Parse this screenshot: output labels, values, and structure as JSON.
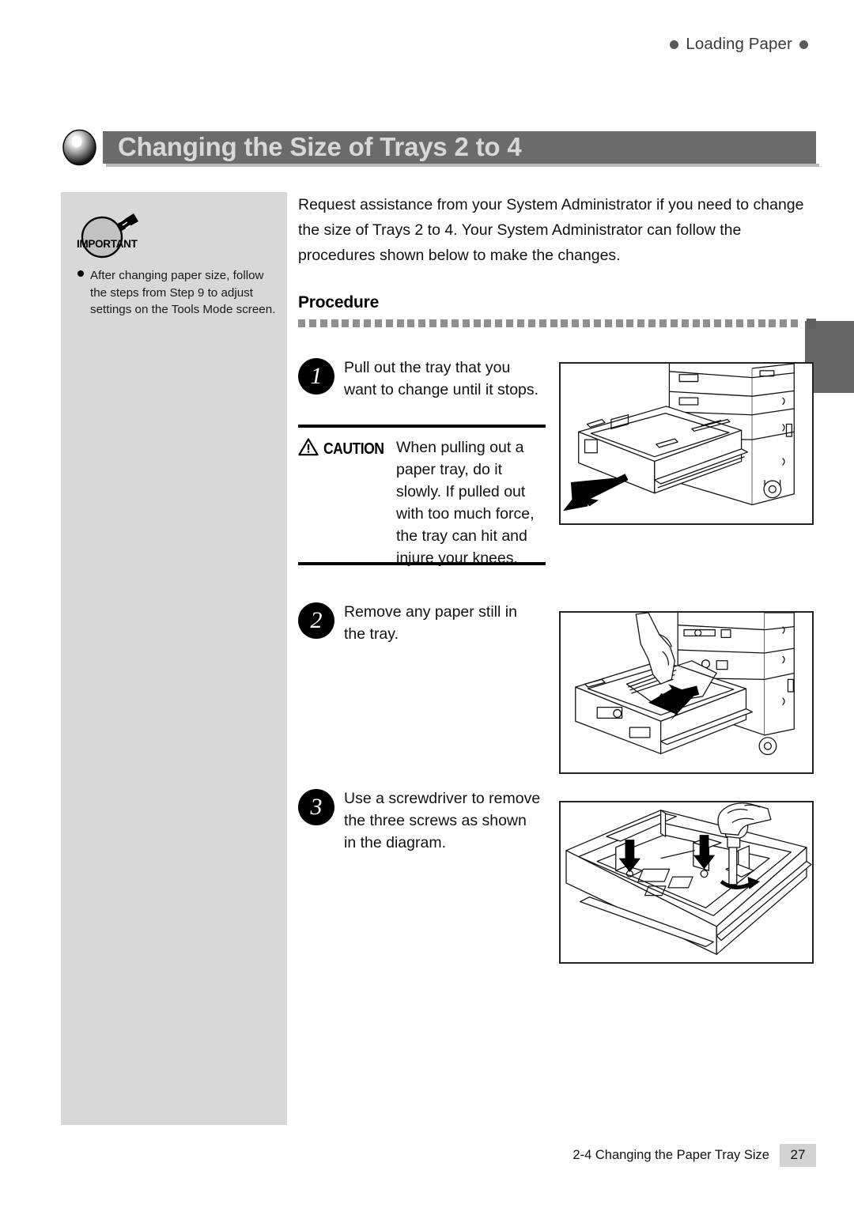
{
  "header": {
    "running_title": "Loading Paper",
    "left_dot_icon": "bullet-dot",
    "right_dot_icon": "bullet-dot"
  },
  "title": {
    "text": "Changing the Size of Trays 2 to 4",
    "icon": "sphere-bullet-icon",
    "bar_color": "#6b6b6b",
    "text_color": "#d8d8d8"
  },
  "sidebar": {
    "background_color": "#d8d8d8",
    "note": {
      "icon": "magnifier-icon",
      "label": "IMPORTANT",
      "bullet_icon": "bullet-dot",
      "text": "After changing paper size, follow the steps from Step 9 to adjust settings on the Tools Mode screen."
    }
  },
  "thumb_tab": {
    "color": "#666666"
  },
  "intro": {
    "text": "Request assistance from your System Administrator if you need to change the size of Trays 2 to 4. Your System Administrator can follow the procedures shown below to make the changes."
  },
  "procedure": {
    "heading": "Procedure",
    "divider_icon": "dotted-square-rule",
    "divider_square_count": 46,
    "divider_color": "#8f8f8f",
    "divider_endcap_color": "#5f5f5f"
  },
  "steps": [
    {
      "number": "1",
      "text": "Pull out the tray that you want to change until it stops.",
      "figure": {
        "name": "tray-pulled-out-figure",
        "alt": "Copier with paper tray pulled out and an arrow pointing out and down-left",
        "arrow_icon": "arrow-down-left"
      }
    },
    {
      "number": "2",
      "text": "Remove any paper still in the tray.",
      "figure": {
        "name": "remove-paper-figure",
        "alt": "A hand lifting paper out of the open tray with an arrow pointing left",
        "arrow_icon": "arrow-left"
      }
    },
    {
      "number": "3",
      "text": "Use a screwdriver to remove the three screws as shown in the diagram.",
      "figure": {
        "name": "remove-screws-figure",
        "alt": "A screwdriver removing screws inside the tray, two down arrows mark screw positions and a curved arrow shows turning",
        "arrow_icon": "arrow-down",
        "rotate_icon": "curved-rotate-arrow"
      }
    }
  ],
  "caution": {
    "icon": "warning-triangle-icon",
    "label": "CAUTION",
    "text": "When pulling out a paper tray, do it slowly. If pulled out with too much force, the tray can hit and injure your knees."
  },
  "footer": {
    "section_title": "2-4 Changing the Paper Tray Size",
    "page_number": "27",
    "page_box_color": "#d2d2d2"
  }
}
